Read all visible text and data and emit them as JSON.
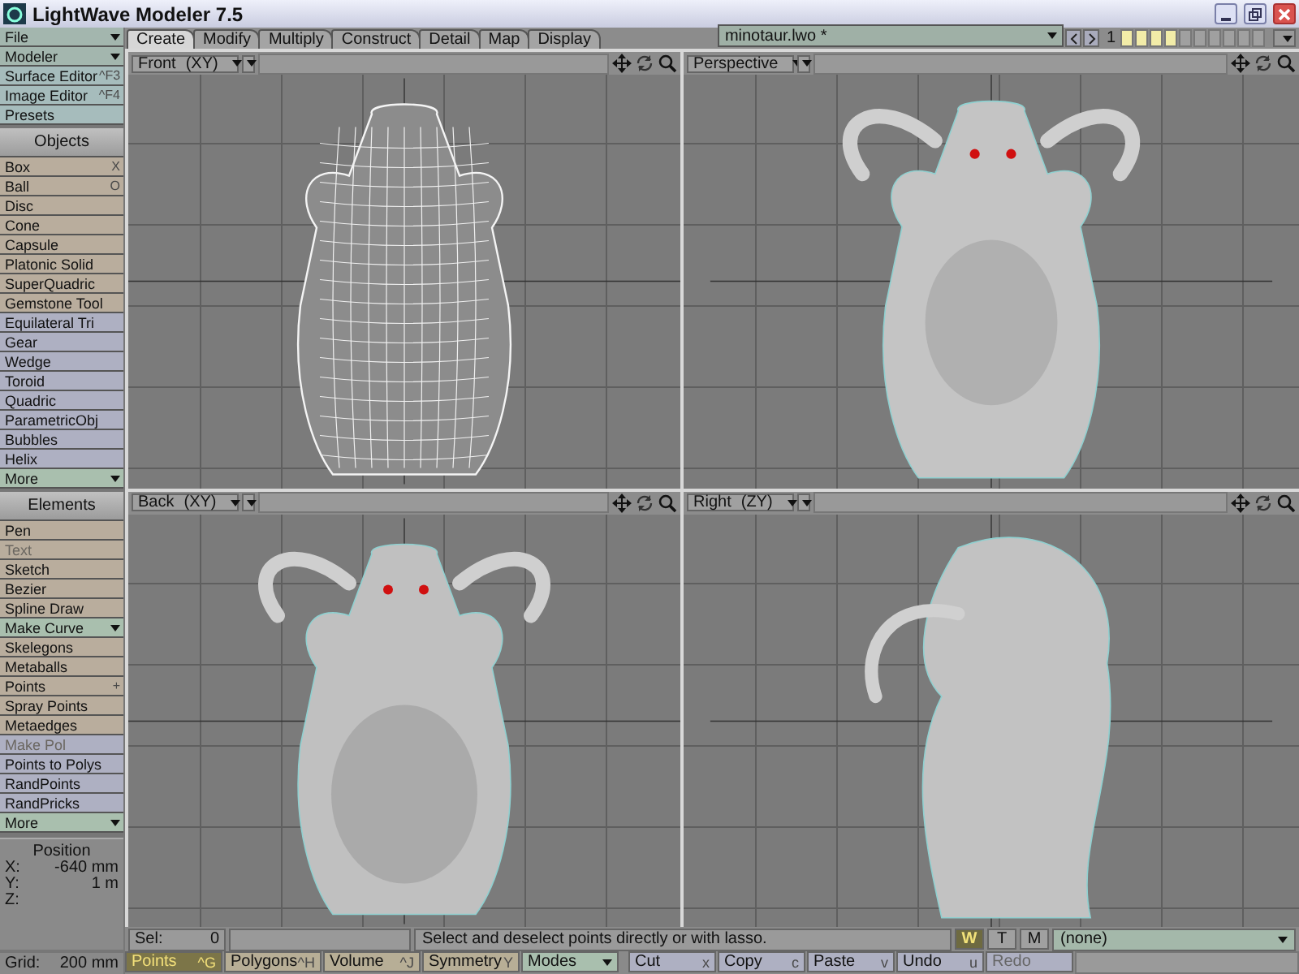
{
  "window": {
    "title": "LightWave Modeler 7.5"
  },
  "sidebar": {
    "menus": [
      {
        "label": "File",
        "kind": "dropdown"
      },
      {
        "label": "Modeler",
        "kind": "dropdown"
      },
      {
        "label": "Surface Editor",
        "shortcut": "^F3",
        "kind": "menu"
      },
      {
        "label": "Image Editor",
        "shortcut": "^F4",
        "kind": "menu"
      },
      {
        "label": "Presets",
        "kind": "menu"
      }
    ],
    "sections": [
      {
        "title": "Objects",
        "items": [
          {
            "label": "Box",
            "shortcut": "X",
            "kind": "tool",
            "disabled": false
          },
          {
            "label": "Ball",
            "shortcut": "O",
            "kind": "tool",
            "disabled": false
          },
          {
            "label": "Disc",
            "kind": "tool",
            "disabled": false
          },
          {
            "label": "Cone",
            "kind": "tool",
            "disabled": false
          },
          {
            "label": "Capsule",
            "kind": "tool",
            "disabled": false
          },
          {
            "label": "Platonic Solid",
            "kind": "tool",
            "disabled": false
          },
          {
            "label": "SuperQuadric",
            "kind": "tool",
            "disabled": false
          },
          {
            "label": "Gemstone Tool",
            "kind": "tool",
            "disabled": false
          },
          {
            "label": "Equilateral Tri",
            "kind": "plugin",
            "disabled": false
          },
          {
            "label": "Gear",
            "kind": "plugin",
            "disabled": false
          },
          {
            "label": "Wedge",
            "kind": "plugin",
            "disabled": false
          },
          {
            "label": "Toroid",
            "kind": "plugin",
            "disabled": false
          },
          {
            "label": "Quadric",
            "kind": "plugin",
            "disabled": false
          },
          {
            "label": "ParametricObj",
            "kind": "plugin",
            "disabled": false
          },
          {
            "label": "Bubbles",
            "kind": "plugin",
            "disabled": false
          },
          {
            "label": "Helix",
            "kind": "plugin",
            "disabled": false
          },
          {
            "label": "More",
            "kind": "dropdown",
            "disabled": false
          }
        ]
      },
      {
        "title": "Elements",
        "items": [
          {
            "label": "Pen",
            "kind": "tool",
            "disabled": false
          },
          {
            "label": "Text",
            "kind": "tool",
            "disabled": true
          },
          {
            "label": "Sketch",
            "kind": "tool",
            "disabled": false
          },
          {
            "label": "Bezier",
            "kind": "tool",
            "disabled": false
          },
          {
            "label": "Spline Draw",
            "kind": "tool",
            "disabled": false
          },
          {
            "label": "Make Curve",
            "kind": "dropdown",
            "disabled": false
          },
          {
            "label": "Skelegons",
            "kind": "tool",
            "disabled": false
          },
          {
            "label": "Metaballs",
            "kind": "tool",
            "disabled": false
          },
          {
            "label": "Points",
            "shortcut": "+",
            "kind": "tool",
            "disabled": false
          },
          {
            "label": "Spray Points",
            "kind": "tool",
            "disabled": false
          },
          {
            "label": "Metaedges",
            "kind": "tool",
            "disabled": false
          },
          {
            "label": "Make Pol",
            "kind": "plugin",
            "disabled": true
          },
          {
            "label": "Points to Polys",
            "kind": "plugin",
            "disabled": false
          },
          {
            "label": "RandPoints",
            "kind": "plugin",
            "disabled": false
          },
          {
            "label": "RandPricks",
            "kind": "plugin",
            "disabled": false
          },
          {
            "label": "More",
            "kind": "dropdown",
            "disabled": false
          }
        ]
      }
    ],
    "position": {
      "title": "Position",
      "rows": [
        {
          "axis": "X:",
          "value": "-640 mm"
        },
        {
          "axis": "Y:",
          "value": "1 m"
        },
        {
          "axis": "Z:"
        }
      ]
    },
    "grid": {
      "label": "Grid:",
      "value": "200 mm"
    }
  },
  "tabs": [
    {
      "label": "Create",
      "selected": true
    },
    {
      "label": "Modify",
      "selected": false
    },
    {
      "label": "Multiply",
      "selected": false
    },
    {
      "label": "Construct",
      "selected": false
    },
    {
      "label": "Detail",
      "selected": false
    },
    {
      "label": "Map",
      "selected": false
    },
    {
      "label": "Display",
      "selected": false
    }
  ],
  "object_selector": {
    "value": "minotaur.lwo *"
  },
  "layer_bank": "1",
  "layers": [
    {
      "foreground": true
    },
    {
      "foreground": true
    },
    {
      "foreground": true
    },
    {
      "foreground": true
    },
    {
      "foreground": false
    },
    {
      "foreground": false
    },
    {
      "foreground": false
    },
    {
      "foreground": false
    },
    {
      "foreground": false
    },
    {
      "foreground": false
    }
  ],
  "viewports": [
    {
      "title": "Front",
      "projection": "(XY)",
      "kind": "wireframe"
    },
    {
      "title": "Perspective",
      "kind": "perspective"
    },
    {
      "title": "Back",
      "projection": "(XY)",
      "kind": "shaded"
    },
    {
      "title": "Right",
      "projection": "(ZY)",
      "kind": "side"
    }
  ],
  "status": {
    "sel_label": "Sel:",
    "sel_count": "0",
    "message": "Select and deselect points directly or with lasso.",
    "view_modes": [
      {
        "label": "W",
        "selected": true
      },
      {
        "label": "T",
        "selected": false
      },
      {
        "label": "M",
        "selected": false
      }
    ],
    "surface": "(none)"
  },
  "toolbar": [
    {
      "label": "Points",
      "shortcut": "^G",
      "kind": "mode",
      "selected": true,
      "disabled": false
    },
    {
      "label": "Polygons",
      "shortcut": "^H",
      "kind": "mode",
      "selected": false,
      "disabled": false
    },
    {
      "label": "Volume",
      "shortcut": "^J",
      "kind": "mode",
      "selected": false,
      "disabled": false
    },
    {
      "label": "Symmetry",
      "shortcut": "Y",
      "kind": "toggle",
      "disabled": false
    },
    {
      "label": "Modes",
      "kind": "dropdown",
      "disabled": false
    },
    {
      "label": "Cut",
      "shortcut": "x",
      "kind": "action",
      "disabled": false
    },
    {
      "label": "Copy",
      "shortcut": "c",
      "kind": "action",
      "disabled": false
    },
    {
      "label": "Paste",
      "shortcut": "v",
      "kind": "action",
      "disabled": false
    },
    {
      "label": "Undo",
      "shortcut": "u",
      "kind": "action",
      "disabled": false
    },
    {
      "label": "Redo",
      "kind": "action",
      "disabled": true
    }
  ]
}
